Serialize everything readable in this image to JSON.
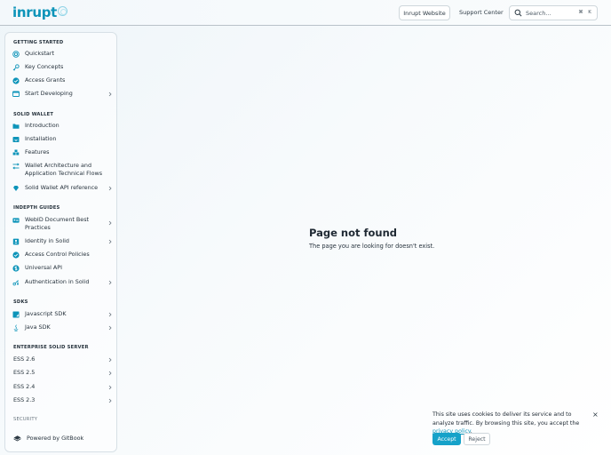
{
  "header": {
    "logo": "inrupt",
    "website_button": "Inrupt Website",
    "support_link": "Support Center",
    "search_placeholder": "Search...",
    "shortcut_mod": "⌘",
    "shortcut_key": "K"
  },
  "sidebar": {
    "sections": [
      {
        "title": "GETTING STARTED",
        "items": [
          {
            "label": "Quickstart",
            "icon": "target-icon",
            "chevron": false
          },
          {
            "label": "Key Concepts",
            "icon": "key-icon",
            "chevron": false
          },
          {
            "label": "Access Grants",
            "icon": "check-circle-icon",
            "chevron": false
          },
          {
            "label": "Start Developing",
            "icon": "code-window-icon",
            "chevron": true
          }
        ]
      },
      {
        "title": "SOLID WALLET",
        "items": [
          {
            "label": "Introduction",
            "icon": "folder-icon",
            "chevron": false
          },
          {
            "label": "Installation",
            "icon": "download-window-icon",
            "chevron": false
          },
          {
            "label": "Features",
            "icon": "cubes-icon",
            "chevron": false
          },
          {
            "label": "Wallet Architecture and Application Technical Flows",
            "icon": "flow-icon",
            "chevron": false
          },
          {
            "label": "Solid Wallet API reference",
            "icon": "diamond-icon",
            "chevron": true
          }
        ]
      },
      {
        "title": "INDEPTH GUIDES",
        "items": [
          {
            "label": "WebID Document Best Practices",
            "icon": "id-card-icon",
            "chevron": true
          },
          {
            "label": "Identity in Solid",
            "icon": "identity-icon",
            "chevron": true
          },
          {
            "label": "Access Control Policies",
            "icon": "check-circle-icon",
            "chevron": false
          },
          {
            "label": "Universal API",
            "icon": "dollar-circle-icon",
            "chevron": false
          },
          {
            "label": "Authentication in Solid",
            "icon": "keys-icon",
            "chevron": true
          }
        ]
      },
      {
        "title": "SDKS",
        "items": [
          {
            "label": "Javascript SDK",
            "icon": "js-icon",
            "chevron": true
          },
          {
            "label": "Java SDK",
            "icon": "java-icon",
            "chevron": true
          }
        ]
      },
      {
        "title": "ENTERPRISE SOLID SERVER",
        "items": [
          {
            "label": "ESS 2.6",
            "icon": "",
            "chevron": true
          },
          {
            "label": "ESS 2.5",
            "icon": "",
            "chevron": true
          },
          {
            "label": "ESS 2.4",
            "icon": "",
            "chevron": true
          },
          {
            "label": "ESS 2.3",
            "icon": "",
            "chevron": true
          }
        ]
      },
      {
        "title": "SECURITY",
        "items": []
      }
    ],
    "powered_by": "Powered by GitBook"
  },
  "main": {
    "title": "Page not found",
    "description": "The page you are looking for doesn't exist."
  },
  "cookie": {
    "text": "This site uses cookies to deliver its service and to analyze traffic. By browsing this site, you accept the ",
    "link": "privacy policy",
    "text_end": ".",
    "accept": "Accept",
    "reject": "Reject",
    "close": "×"
  },
  "colors": {
    "accent": "#0d94b9",
    "accept_bg": "#16a2c9"
  }
}
